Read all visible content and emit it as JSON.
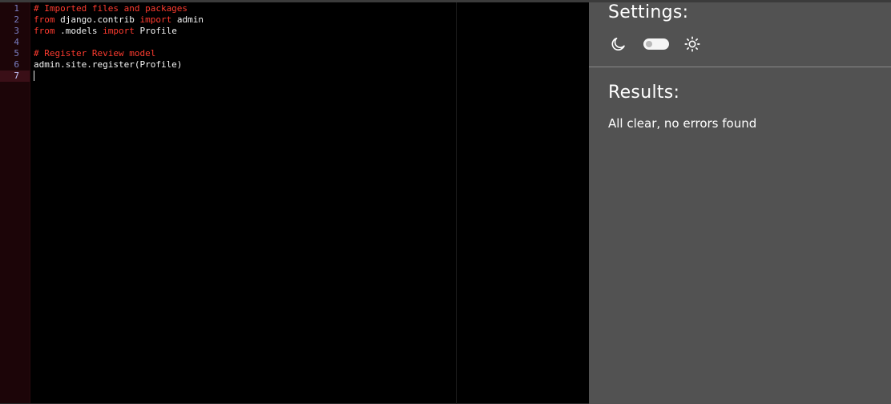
{
  "editor": {
    "line_numbers": [
      "1",
      "2",
      "3",
      "4",
      "5",
      "6",
      "7"
    ],
    "active_line": 7,
    "lines": [
      [
        {
          "type": "comment",
          "text": "# Imported files and packages"
        }
      ],
      [
        {
          "type": "keyword",
          "text": "from"
        },
        {
          "type": "plain",
          "text": " django.contrib "
        },
        {
          "type": "keyword",
          "text": "import"
        },
        {
          "type": "plain",
          "text": " admin"
        }
      ],
      [
        {
          "type": "keyword",
          "text": "from"
        },
        {
          "type": "plain",
          "text": " .models "
        },
        {
          "type": "keyword",
          "text": "import"
        },
        {
          "type": "plain",
          "text": " Profile"
        }
      ],
      [],
      [
        {
          "type": "comment",
          "text": "# Register Review model"
        }
      ],
      [
        {
          "type": "plain",
          "text": "admin.site.register(Profile)"
        }
      ],
      []
    ],
    "colors": {
      "background": "#000000",
      "gutter": "#1c0508",
      "keyword": "#ff3b2f",
      "comment": "#ff3b2f",
      "text": "#f4f4f4"
    }
  },
  "sidebar": {
    "settings_title": "Settings:",
    "theme": {
      "dark_icon": "moon-icon",
      "light_icon": "sun-icon",
      "toggle_state": "dark"
    },
    "results_title": "Results:",
    "results_message": "All clear, no errors found",
    "colors": {
      "background": "#525252",
      "text": "#ffffff"
    }
  }
}
